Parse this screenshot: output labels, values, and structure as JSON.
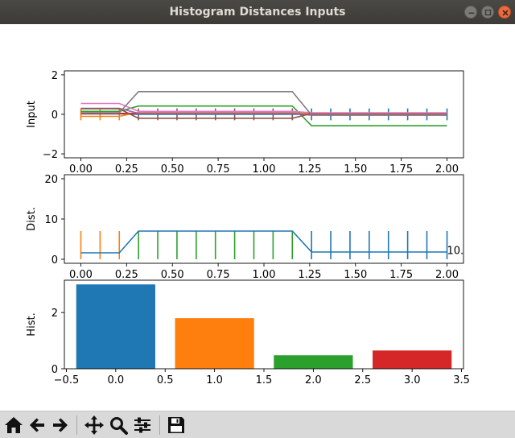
{
  "window": {
    "title": "Histogram Distances Inputs"
  },
  "icons": {
    "minimize": "minimize-icon",
    "maximize": "maximize-icon",
    "close": "close-icon",
    "home": "home-icon",
    "back": "arrow-left-icon",
    "forward": "arrow-right-icon",
    "pan": "move-icon",
    "zoom": "magnifier-icon",
    "configure": "sliders-icon",
    "save": "floppy-disk-icon"
  },
  "chart_data": [
    {
      "type": "line",
      "ylabel": "Input",
      "xlim": [
        -0.09,
        2.09
      ],
      "ylim": [
        -2.2,
        2.2
      ],
      "xticks": [
        "0.00",
        "0.25",
        "0.50",
        "0.75",
        "1.00",
        "1.25",
        "1.50",
        "1.75",
        "2.00"
      ],
      "yticks": [
        "−2",
        "0",
        "2"
      ],
      "x": [
        0.0,
        0.105,
        0.21,
        0.315,
        0.42,
        0.525,
        0.63,
        0.735,
        0.84,
        0.945,
        1.05,
        1.155,
        1.26,
        1.365,
        1.47,
        1.575,
        1.68,
        1.785,
        1.89,
        2.0
      ],
      "series": [
        {
          "color": "#1f77b4",
          "values": [
            0.02,
            0.02,
            0.02,
            0.0,
            0.0,
            0.0,
            0.0,
            0.0,
            0.0,
            0.0,
            0.0,
            0.0,
            0.0,
            0.0,
            0.0,
            0.0,
            0.0,
            0.0,
            0.0,
            0.0
          ]
        },
        {
          "color": "#ff7f0e",
          "values": [
            -0.1,
            -0.1,
            -0.1,
            0.1,
            0.1,
            0.1,
            0.1,
            0.1,
            0.1,
            0.1,
            0.1,
            0.1,
            0.02,
            0.02,
            0.02,
            0.02,
            0.02,
            0.02,
            0.02,
            0.02
          ]
        },
        {
          "color": "#2ca02c",
          "values": [
            0.15,
            0.15,
            0.15,
            0.42,
            0.42,
            0.42,
            0.42,
            0.42,
            0.42,
            0.42,
            0.42,
            0.42,
            -0.58,
            -0.58,
            -0.58,
            -0.58,
            -0.58,
            -0.58,
            -0.58,
            -0.58
          ]
        },
        {
          "color": "#d62728",
          "values": [
            0.05,
            0.05,
            0.05,
            0.05,
            0.05,
            0.05,
            0.05,
            0.05,
            0.05,
            0.05,
            0.05,
            0.05,
            -0.04,
            -0.04,
            -0.04,
            -0.04,
            -0.04,
            -0.04,
            -0.04,
            -0.04
          ]
        },
        {
          "color": "#9467bd",
          "values": [
            0.3,
            0.3,
            0.3,
            0.05,
            0.05,
            0.05,
            0.05,
            0.05,
            0.05,
            0.05,
            0.05,
            0.05,
            -0.02,
            -0.02,
            -0.02,
            -0.02,
            -0.02,
            -0.02,
            -0.02,
            -0.02
          ]
        },
        {
          "color": "#8c564b",
          "values": [
            0.28,
            0.28,
            0.28,
            -0.2,
            -0.2,
            -0.2,
            -0.2,
            -0.2,
            -0.2,
            -0.2,
            -0.2,
            -0.2,
            0.05,
            0.05,
            0.05,
            0.05,
            0.05,
            0.05,
            0.05,
            0.05
          ]
        },
        {
          "color": "#e377c2",
          "values": [
            0.55,
            0.55,
            0.55,
            0.15,
            0.15,
            0.15,
            0.15,
            0.15,
            0.15,
            0.15,
            0.15,
            0.15,
            0.08,
            0.08,
            0.08,
            0.08,
            0.08,
            0.08,
            0.08,
            0.08
          ]
        },
        {
          "color": "#7f7f7f",
          "values": [
            0.08,
            0.08,
            0.08,
            1.15,
            1.15,
            1.15,
            1.15,
            1.15,
            1.15,
            1.15,
            1.15,
            1.15,
            -0.04,
            -0.04,
            -0.04,
            -0.04,
            -0.04,
            -0.04,
            -0.04,
            -0.04
          ]
        }
      ],
      "markers": [
        {
          "x": 0.0,
          "color": "#ff7f0e"
        },
        {
          "x": 0.105,
          "color": "#ff7f0e"
        },
        {
          "x": 0.21,
          "color": "#ff7f0e"
        },
        {
          "x": 0.315,
          "color": "#8c564b"
        },
        {
          "x": 0.42,
          "color": "#8c564b"
        },
        {
          "x": 0.525,
          "color": "#8c564b"
        },
        {
          "x": 0.63,
          "color": "#8c564b"
        },
        {
          "x": 0.735,
          "color": "#8c564b"
        },
        {
          "x": 0.84,
          "color": "#8c564b"
        },
        {
          "x": 0.945,
          "color": "#8c564b"
        },
        {
          "x": 1.05,
          "color": "#8c564b"
        },
        {
          "x": 1.155,
          "color": "#8c564b"
        },
        {
          "x": 1.26,
          "color": "#1f77b4"
        },
        {
          "x": 1.365,
          "color": "#1f77b4"
        },
        {
          "x": 1.47,
          "color": "#1f77b4"
        },
        {
          "x": 1.575,
          "color": "#1f77b4"
        },
        {
          "x": 1.68,
          "color": "#1f77b4"
        },
        {
          "x": 1.785,
          "color": "#1f77b4"
        },
        {
          "x": 1.89,
          "color": "#1f77b4"
        },
        {
          "x": 2.0,
          "color": "#1f77b4"
        }
      ],
      "marker_half_height": 0.3,
      "grid": false
    },
    {
      "type": "line",
      "ylabel": "Dist.",
      "xlim": [
        -0.09,
        2.09
      ],
      "ylim": [
        -1,
        21
      ],
      "xticks": [
        "0.00",
        "0.25",
        "0.50",
        "0.75",
        "1.00",
        "1.25",
        "1.50",
        "1.75",
        "2.00"
      ],
      "yticks": [
        "0",
        "10",
        "20"
      ],
      "x": [
        0.0,
        0.105,
        0.21,
        0.315,
        0.42,
        0.525,
        0.63,
        0.735,
        0.84,
        0.945,
        1.05,
        1.155,
        1.26,
        1.365,
        1.47,
        1.575,
        1.68,
        1.785,
        1.89,
        2.0
      ],
      "series": [
        {
          "color": "#1f77b4",
          "values": [
            1.6,
            1.6,
            1.6,
            7.0,
            7.0,
            7.0,
            7.0,
            7.0,
            7.0,
            7.0,
            7.0,
            7.0,
            1.8,
            1.8,
            1.8,
            1.8,
            1.8,
            1.8,
            1.8,
            1.8
          ]
        }
      ],
      "markers": [
        {
          "x": 0.0,
          "color": "#ff7f0e"
        },
        {
          "x": 0.105,
          "color": "#ff7f0e"
        },
        {
          "x": 0.21,
          "color": "#ff7f0e"
        },
        {
          "x": 0.315,
          "color": "#2ca02c"
        },
        {
          "x": 0.42,
          "color": "#2ca02c"
        },
        {
          "x": 0.525,
          "color": "#2ca02c"
        },
        {
          "x": 0.63,
          "color": "#2ca02c"
        },
        {
          "x": 0.735,
          "color": "#2ca02c"
        },
        {
          "x": 0.84,
          "color": "#2ca02c"
        },
        {
          "x": 0.945,
          "color": "#2ca02c"
        },
        {
          "x": 1.05,
          "color": "#2ca02c"
        },
        {
          "x": 1.155,
          "color": "#2ca02c"
        },
        {
          "x": 1.26,
          "color": "#1f77b4"
        },
        {
          "x": 1.365,
          "color": "#1f77b4"
        },
        {
          "x": 1.47,
          "color": "#1f77b4"
        },
        {
          "x": 1.575,
          "color": "#1f77b4"
        },
        {
          "x": 1.68,
          "color": "#1f77b4"
        },
        {
          "x": 1.785,
          "color": "#1f77b4"
        },
        {
          "x": 1.89,
          "color": "#1f77b4"
        },
        {
          "x": 2.0,
          "color": "#1f77b4"
        }
      ],
      "marker_range": [
        0,
        7
      ],
      "annotation": {
        "text": "10.",
        "x": 2.0,
        "y": 2.3
      },
      "grid": false
    },
    {
      "type": "bar",
      "ylabel": "Hist.",
      "xlim": [
        -0.52,
        3.52
      ],
      "ylim": [
        0,
        3.15
      ],
      "xticks": [
        "−0.5",
        "0.0",
        "0.5",
        "1.0",
        "1.5",
        "2.0",
        "2.5",
        "3.0",
        "3.5"
      ],
      "xtick_values": [
        -0.5,
        0.0,
        0.5,
        1.0,
        1.5,
        2.0,
        2.5,
        3.0,
        3.5
      ],
      "yticks": [
        "0",
        "2"
      ],
      "ytick_values": [
        0,
        2
      ],
      "categories": [
        0,
        1,
        2,
        3
      ],
      "values": [
        3.0,
        1.8,
        0.48,
        0.65
      ],
      "bar_width": 0.8,
      "colors": [
        "#1f77b4",
        "#ff7f0e",
        "#2ca02c",
        "#d62728"
      ],
      "grid": false
    }
  ]
}
